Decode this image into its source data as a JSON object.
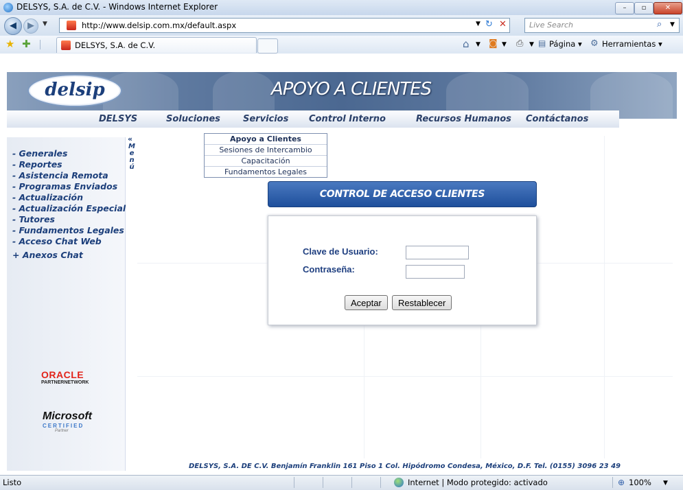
{
  "window": {
    "title": "DELSYS, S.A. de C.V. - Windows Internet Explorer"
  },
  "address": {
    "url": "http://www.delsip.com.mx/default.aspx",
    "search_placeholder": "Live Search"
  },
  "favbar": {
    "tab_title": "DELSYS, S.A. de C.V.",
    "pagina_label": "Página",
    "herramientas_label": "Herramientas"
  },
  "banner": {
    "logo_text": "delsip",
    "title": "APOYO A CLIENTES"
  },
  "menu": [
    "DELSYS",
    "Soluciones",
    "Servicios",
    "Control Interno",
    "Recursos Humanos",
    "Contáctanos"
  ],
  "dropdown": [
    "Apoyo a Clientes",
    "Sesiones de Intercambio",
    "Capacitación",
    "Fundamentos Legales"
  ],
  "sidebar": {
    "items": [
      "- Generales",
      "- Reportes",
      "- Asistencia Remota",
      "- Programas Enviados",
      "- Actualización",
      "- Actualización Especial",
      "- Tutores",
      "- Fundamentos Legales",
      "- Acceso Chat Web",
      "+ Anexos Chat"
    ],
    "collapse_label": "«",
    "vertical_label": [
      "M",
      "e",
      "n",
      "ú"
    ]
  },
  "login": {
    "title": "CONTROL DE ACCESO CLIENTES",
    "user_label": "Clave de Usuario:",
    "password_label": "Contraseña:",
    "user_value": "",
    "password_value": "",
    "accept_label": "Aceptar",
    "reset_label": "Restablecer"
  },
  "partners": {
    "oracle_name": "ORACLE",
    "oracle_sub": "PARTNERNETWORK",
    "ms_name": "Microsoft",
    "ms_certified": "CERTIFIED",
    "ms_partner": "Partner"
  },
  "footer": "DELSYS, S.A. DE C.V.  Benjamín Franklin 161 Piso 1  Col. Hipódromo Condesa,  México, D.F.  Tel. (0155) 3096 23 49",
  "status": {
    "left": "Listo",
    "zone": "Internet | Modo protegido: activado",
    "zoom": "100%"
  },
  "colors": {
    "brand_blue": "#1c3f7b",
    "title_gradient_top": "#4a79c0",
    "label_blue": "#1f3f80"
  },
  "icons": [
    "ie-icon",
    "back-icon",
    "forward-icon",
    "refresh-icon",
    "stop-icon",
    "search-icon",
    "star-icon",
    "add-favorite-icon",
    "home-icon",
    "feeds-icon",
    "print-icon",
    "page-icon",
    "tools-icon",
    "globe-icon",
    "zoom-icon"
  ]
}
